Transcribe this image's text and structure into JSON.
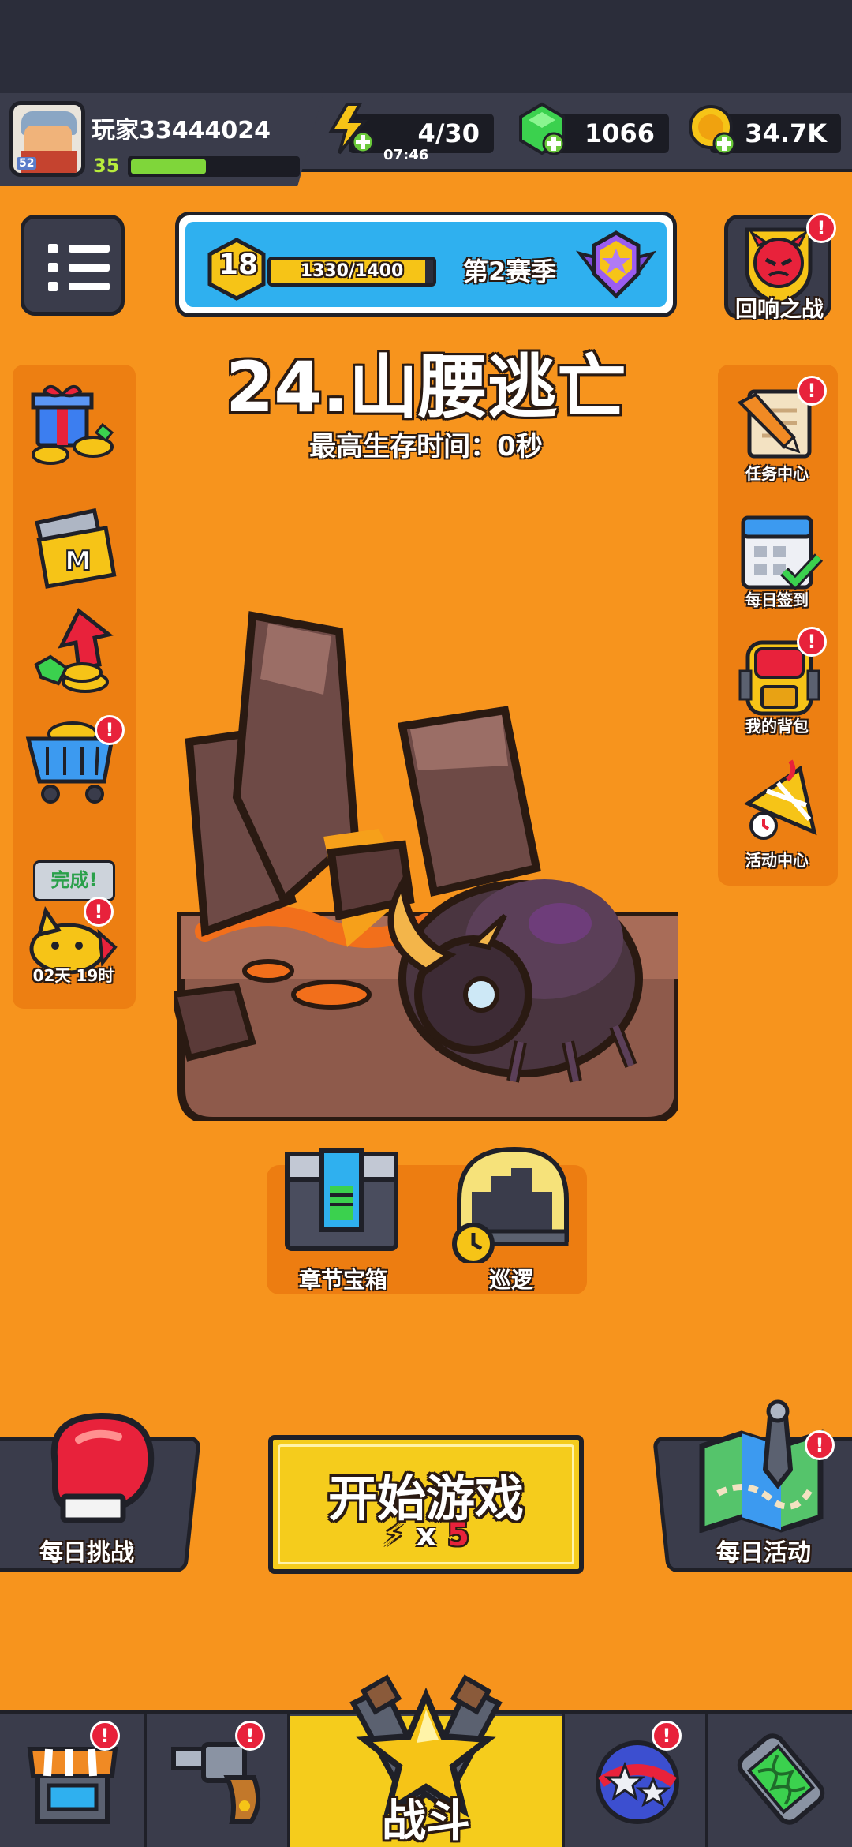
{
  "player": {
    "name": "玩家33444024",
    "level": "35",
    "avatar_tag": "52",
    "xp_fraction": 0.45
  },
  "resources": {
    "energy": "4/30",
    "energy_timer": "07:46",
    "gems": "1066",
    "coins": "34.7K"
  },
  "season": {
    "level": "18",
    "progress": "1330/1400",
    "progress_fraction": 0.95,
    "label": "第2赛季"
  },
  "echo_battle": {
    "label": "回响之战"
  },
  "stage": {
    "title": "24.山腰逃亡",
    "best_survival": "最高生存时间：0秒"
  },
  "left_sidebar": {
    "done_tag": "完成!",
    "timer": "02天 19时"
  },
  "right_sidebar": {
    "items": [
      {
        "label": "任务中心",
        "icon": "quest-scroll-icon"
      },
      {
        "label": "每日签到",
        "icon": "calendar-check-icon"
      },
      {
        "label": "我的背包",
        "icon": "backpack-icon"
      },
      {
        "label": "活动中心",
        "icon": "party-horn-icon"
      }
    ]
  },
  "rewards": {
    "chest_label": "章节宝箱",
    "patrol_label": "巡逻"
  },
  "actions": {
    "daily_challenge": "每日挑战",
    "start_game": "开始游戏",
    "start_cost_prefix": "x",
    "start_cost": "5",
    "daily_activity": "每日活动"
  },
  "nav": {
    "battle": "战斗"
  },
  "colors": {
    "background": "#f7941d",
    "panel": "#3a3c4b",
    "accent_yellow": "#f5cc1c",
    "alert_red": "#e8223b",
    "season_blue": "#2fb0ef"
  }
}
